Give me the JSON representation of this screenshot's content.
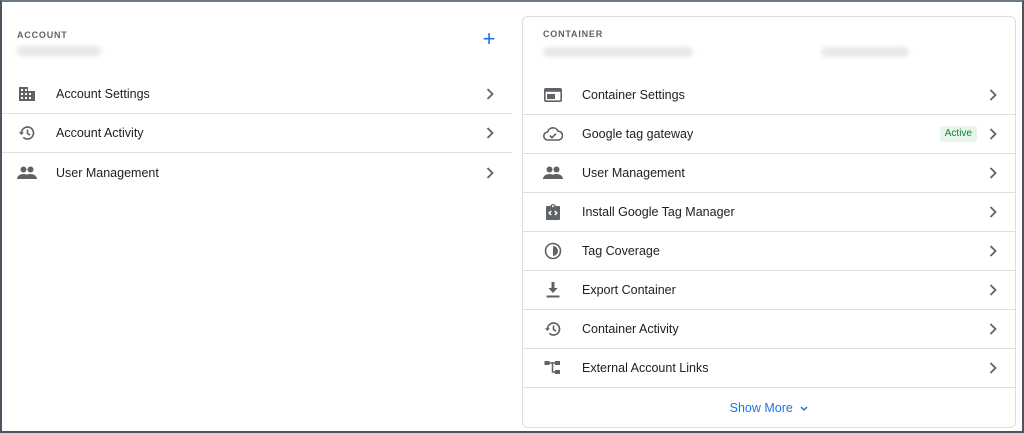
{
  "account": {
    "section_label": "ACCOUNT",
    "add_label": "+",
    "items": [
      {
        "icon": "building-icon",
        "label": "Account Settings"
      },
      {
        "icon": "history-icon",
        "label": "Account Activity"
      },
      {
        "icon": "people-icon",
        "label": "User Management"
      }
    ]
  },
  "container": {
    "section_label": "CONTAINER",
    "items": [
      {
        "icon": "web-window-icon",
        "label": "Container Settings"
      },
      {
        "icon": "cloud-check-icon",
        "label": "Google tag gateway",
        "badge": "Active"
      },
      {
        "icon": "people-icon",
        "label": "User Management"
      },
      {
        "icon": "code-clipboard-icon",
        "label": "Install Google Tag Manager"
      },
      {
        "icon": "coverage-icon",
        "label": "Tag Coverage"
      },
      {
        "icon": "download-icon",
        "label": "Export Container"
      },
      {
        "icon": "history-icon",
        "label": "Container Activity"
      },
      {
        "icon": "account-tree-icon",
        "label": "External Account Links"
      }
    ],
    "show_more_label": "Show More"
  },
  "colors": {
    "accent": "#1a73e8",
    "badge_bg": "#e6f4ea",
    "badge_text": "#188038",
    "icon": "#5f6368"
  }
}
